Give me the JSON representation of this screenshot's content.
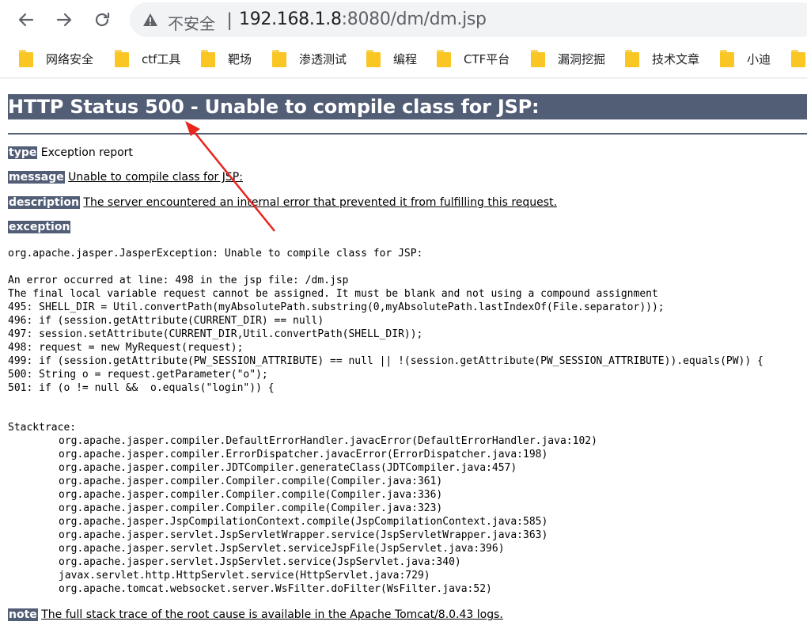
{
  "browser": {
    "insecure_label": "不安全",
    "url_host": "192.168.1.8",
    "url_rest": ":8080/dm/dm.jsp",
    "bookmarks": [
      "网络安全",
      "ctf工具",
      "靶场",
      "渗透测试",
      "编程",
      "CTF平台",
      "漏洞挖掘",
      "技术文章",
      "小迪"
    ]
  },
  "page": {
    "title": "HTTP Status 500 - Unable to compile class for JSP:",
    "type_label": "type",
    "type_value": "Exception report",
    "message_label": "message",
    "message_value": "Unable to compile class for JSP:",
    "description_label": "description",
    "description_value": "The server encountered an internal error that prevented it from fulfilling this request.",
    "exception_label": "exception",
    "exception_line": "org.apache.jasper.JasperException: Unable to compile class for JSP:",
    "error_lines": [
      "An error occurred at line: 498 in the jsp file: /dm.jsp",
      "The final local variable request cannot be assigned. It must be blank and not using a compound assignment",
      "495: SHELL_DIR = Util.convertPath(myAbsolutePath.substring(0,myAbsolutePath.lastIndexOf(File.separator)));",
      "496: if (session.getAttribute(CURRENT_DIR) == null)",
      "497: session.setAttribute(CURRENT_DIR,Util.convertPath(SHELL_DIR));",
      "498: request = new MyRequest(request);",
      "499: if (session.getAttribute(PW_SESSION_ATTRIBUTE) == null || !(session.getAttribute(PW_SESSION_ATTRIBUTE)).equals(PW)) {",
      "500: String o = request.getParameter(\"o\");",
      "501: if (o != null &&  o.equals(\"login\")) {"
    ],
    "stacktrace_label": "Stacktrace:",
    "stacktrace": [
      "org.apache.jasper.compiler.DefaultErrorHandler.javacError(DefaultErrorHandler.java:102)",
      "org.apache.jasper.compiler.ErrorDispatcher.javacError(ErrorDispatcher.java:198)",
      "org.apache.jasper.compiler.JDTCompiler.generateClass(JDTCompiler.java:457)",
      "org.apache.jasper.compiler.Compiler.compile(Compiler.java:361)",
      "org.apache.jasper.compiler.Compiler.compile(Compiler.java:336)",
      "org.apache.jasper.compiler.Compiler.compile(Compiler.java:323)",
      "org.apache.jasper.JspCompilationContext.compile(JspCompilationContext.java:585)",
      "org.apache.jasper.servlet.JspServletWrapper.service(JspServletWrapper.java:363)",
      "org.apache.jasper.servlet.JspServlet.serviceJspFile(JspServlet.java:396)",
      "org.apache.jasper.servlet.JspServlet.service(JspServlet.java:340)",
      "javax.servlet.http.HttpServlet.service(HttpServlet.java:729)",
      "org.apache.tomcat.websocket.server.WsFilter.doFilter(WsFilter.java:52)"
    ],
    "note_label": "note",
    "note_value": "The full stack trace of the root cause is available in the Apache Tomcat/8.0.43 logs."
  },
  "colors": {
    "header_bg": "#525d76",
    "arrow": "#e8251f",
    "bookmark_folder": "#f9c623"
  }
}
